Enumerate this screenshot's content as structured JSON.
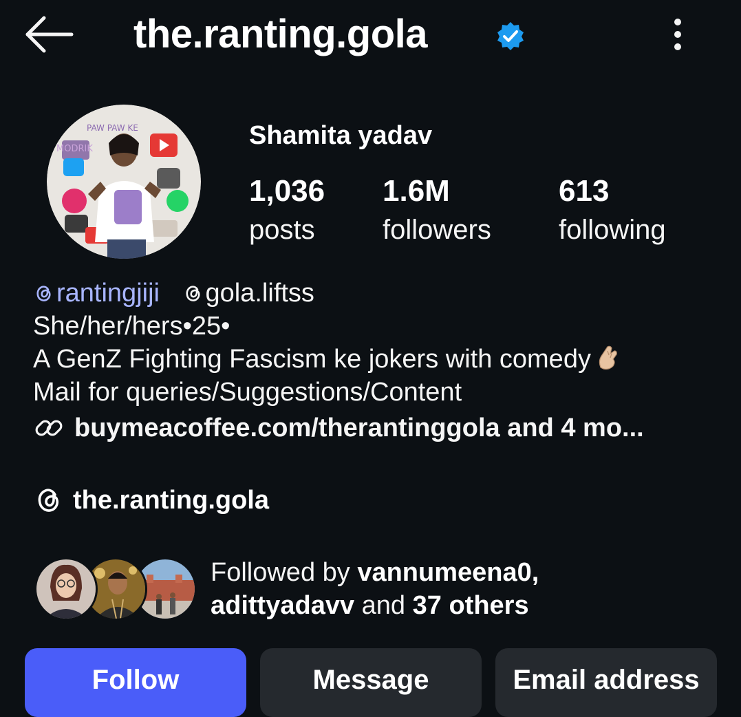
{
  "header": {
    "title": "the.ranting.gola",
    "back_icon": "arrow-left-icon",
    "verified_icon": "verified-badge-icon",
    "more_icon": "more-vertical-icon",
    "verified_color": "#1d9bf0"
  },
  "profile": {
    "display_name": "Shamita yadav",
    "stats": [
      {
        "value": "1,036",
        "label": "posts"
      },
      {
        "value": "1.6M",
        "label": "followers"
      },
      {
        "value": "613",
        "label": "following"
      }
    ]
  },
  "bio": {
    "handles": [
      {
        "text": "rantingjiji",
        "color": "#a8b5ff"
      },
      {
        "text": "gola.liftss",
        "color": "#f5f5f5"
      }
    ],
    "pronouns": "She/her/hers•25•",
    "tagline": "A GenZ Fighting Fascism ke jokers with comedy",
    "tagline_emoji": "pinched-fingers-emoji",
    "mail_line": "Mail for queries/Suggestions/Content",
    "link_text": "buymeacoffee.com/therantinggola and 4 mo...",
    "link_icon": "link-icon"
  },
  "threads": {
    "icon": "threads-icon",
    "text": "the.ranting.gola"
  },
  "mutuals": {
    "prefix": "Followed by ",
    "name1": "vannumeena0,",
    "name2": "adittyadavv",
    "middle": " and ",
    "others": "37 others"
  },
  "actions": {
    "follow": "Follow",
    "message": "Message",
    "email": "Email address",
    "follow_color": "#4a5df9",
    "secondary_color": "#25292e"
  },
  "colors": {
    "background": "#0c1014",
    "text": "#f5f5f5"
  }
}
